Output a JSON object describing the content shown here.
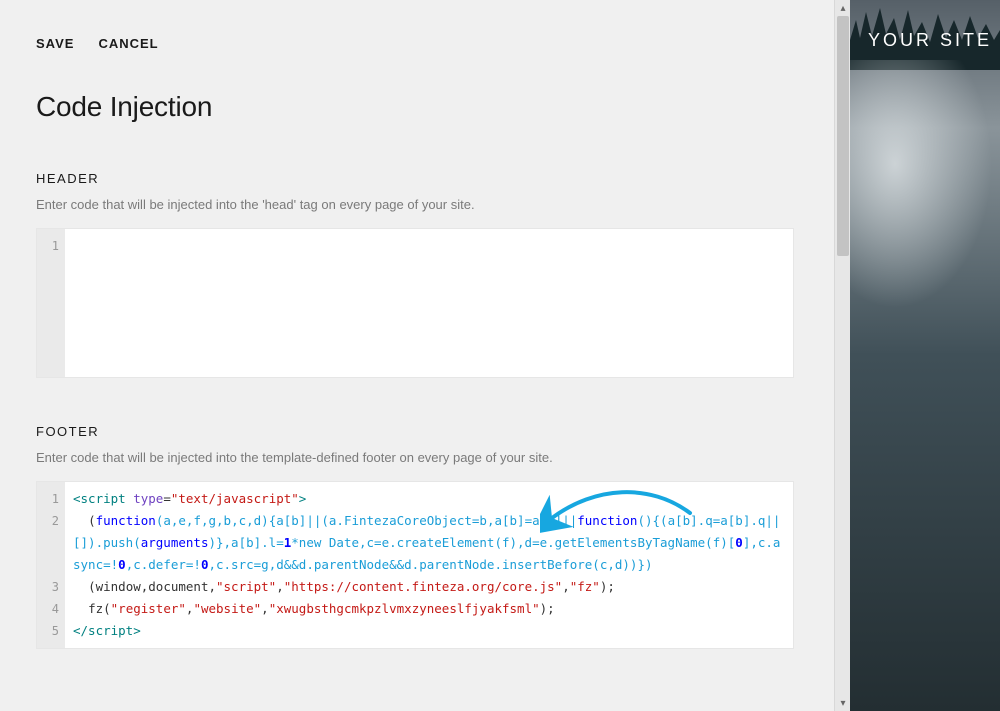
{
  "actions": {
    "save": "SAVE",
    "cancel": "CANCEL"
  },
  "page_title": "Code Injection",
  "header_section": {
    "label": "HEADER",
    "desc": "Enter code that will be injected into the 'head' tag on every page of your site.",
    "gutter": [
      "1"
    ],
    "code_plain": ""
  },
  "footer_section": {
    "label": "FOOTER",
    "desc": "Enter code that will be injected into the template-defined footer on every page of your site.",
    "gutter": [
      "1",
      "2",
      "",
      "",
      "3",
      "4",
      "5"
    ],
    "code": {
      "l1_open_tag": "<script",
      "l1_attr": " type",
      "l1_eq": "=",
      "l1_str": "\"text/javascript\"",
      "l1_close": ">",
      "l2_indent": "  (",
      "l2_func": "function",
      "l2_args": "(a,e,f,g,b,c,d){a[b]||(a.FintezaCoreObject=b,a[b]=a[b]||",
      "l2_func2": "function",
      "l2_tail": "(){(a[b].q=a[b].q||[]).push(",
      "l2_arguments": "arguments",
      "l2_after_args": ")},a[b].l=",
      "l2_one": "1",
      "l2_star_new": "*new Date,c=e.createElement(f),d=e.getElementsByTagName(f)[",
      "l2_zero": "0",
      "l2_after_zero": "],c.async=!",
      "l2_zero2": "0",
      "l2_defer": ",c.defer=!",
      "l2_zero3": "0",
      "l2_src": ",c.src=g,d&&d.parentNode&&d.parentNode.insertBefore(c,d))})",
      "l3_indent": "  (window,document,",
      "l3_s1": "\"script\"",
      "l3_c1": ",",
      "l3_s2": "\"https://content.finteza.org/core.js\"",
      "l3_c2": ",",
      "l3_s3": "\"fz\"",
      "l3_end": ");",
      "l4_indent": "  fz(",
      "l4_s1": "\"register\"",
      "l4_c1": ",",
      "l4_s2": "\"website\"",
      "l4_c2": ",",
      "l4_s3": "\"xwugbsthgcmkpzlvmxzyneeslfjyakfsml\"",
      "l4_end": ");",
      "l5_close": "</script>"
    }
  },
  "preview": {
    "site_title": "YOUR SITE"
  }
}
